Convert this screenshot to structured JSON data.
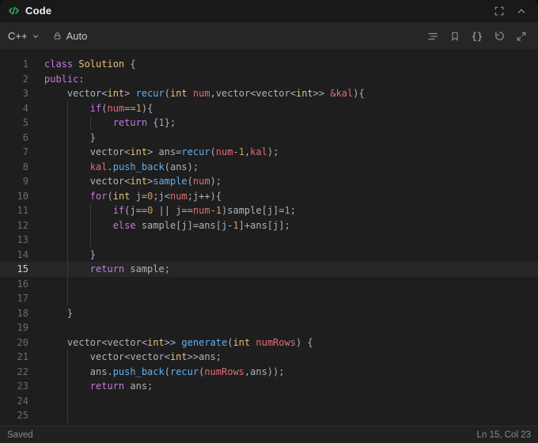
{
  "header": {
    "title": "Code"
  },
  "toolbar": {
    "language": "C++",
    "autocomplete_label": "Auto",
    "braces_glyph": "{}"
  },
  "status_bar": {
    "save_status": "Saved",
    "cursor_position": "Ln 15, Col 23"
  },
  "icons": {
    "header_left": "code-icon",
    "header_right": [
      "fit-screen-icon",
      "collapse-panel-icon"
    ],
    "language_selector": "chevron-down-icon",
    "autocomplete": "lock-icon",
    "toolbar_right": [
      "format-icon",
      "bookmark-icon",
      "braces-icon",
      "reset-icon",
      "fullscreen-icon"
    ]
  },
  "colors": {
    "green": "#2cbb5d",
    "kw": "#c678dd",
    "ty": "#e5c07b",
    "fn": "#61afef",
    "pm": "#e06c75",
    "nu": "#d19a66",
    "pl": "#abb2bf"
  },
  "editor": {
    "active_line": 15,
    "lines": [
      [
        [
          "kw",
          "class"
        ],
        [
          "pl",
          " "
        ],
        [
          "ty",
          "Solution"
        ],
        [
          "pl",
          " {"
        ]
      ],
      [
        [
          "kw",
          "public"
        ],
        [
          "pl",
          ":"
        ]
      ],
      [
        [
          "pl",
          "    vector<"
        ],
        [
          "ty",
          "int"
        ],
        [
          "pl",
          "> "
        ],
        [
          "fn",
          "recur"
        ],
        [
          "pl",
          "("
        ],
        [
          "ty",
          "int"
        ],
        [
          "pl",
          " "
        ],
        [
          "pm",
          "num"
        ],
        [
          "pl",
          ",vector<vector<"
        ],
        [
          "ty",
          "int"
        ],
        [
          "pl",
          ">> "
        ],
        [
          "pm",
          "&kal"
        ],
        [
          "pl",
          "){"
        ]
      ],
      [
        [
          "pl",
          "        "
        ],
        [
          "kw",
          "if"
        ],
        [
          "pl",
          "("
        ],
        [
          "pm",
          "num"
        ],
        [
          "pl",
          "=="
        ],
        [
          "nu",
          "1"
        ],
        [
          "pl",
          "){"
        ]
      ],
      [
        [
          "pl",
          "            "
        ],
        [
          "kw",
          "return"
        ],
        [
          "pl",
          " {"
        ],
        [
          "nu",
          "1"
        ],
        [
          "pl",
          "};"
        ]
      ],
      [
        [
          "pl",
          "        }"
        ]
      ],
      [
        [
          "pl",
          "        vector<"
        ],
        [
          "ty",
          "int"
        ],
        [
          "pl",
          "> ans="
        ],
        [
          "fn",
          "recur"
        ],
        [
          "pl",
          "("
        ],
        [
          "pm",
          "num"
        ],
        [
          "pl",
          "-"
        ],
        [
          "nu",
          "1"
        ],
        [
          "pl",
          ","
        ],
        [
          "pm",
          "kal"
        ],
        [
          "pl",
          ");"
        ]
      ],
      [
        [
          "pl",
          "        "
        ],
        [
          "pm",
          "kal"
        ],
        [
          "pl",
          "."
        ],
        [
          "fn",
          "push_back"
        ],
        [
          "pl",
          "(ans);"
        ]
      ],
      [
        [
          "pl",
          "        vector<"
        ],
        [
          "ty",
          "int"
        ],
        [
          "pl",
          ">"
        ],
        [
          "fn",
          "sample"
        ],
        [
          "pl",
          "("
        ],
        [
          "pm",
          "num"
        ],
        [
          "pl",
          ");"
        ]
      ],
      [
        [
          "pl",
          "        "
        ],
        [
          "kw",
          "for"
        ],
        [
          "pl",
          "("
        ],
        [
          "ty",
          "int"
        ],
        [
          "pl",
          " j="
        ],
        [
          "nu",
          "0"
        ],
        [
          "pl",
          ";j<"
        ],
        [
          "pm",
          "num"
        ],
        [
          "pl",
          ";j++){"
        ]
      ],
      [
        [
          "pl",
          "            "
        ],
        [
          "kw",
          "if"
        ],
        [
          "pl",
          "(j=="
        ],
        [
          "nu",
          "0"
        ],
        [
          "pl",
          " || j=="
        ],
        [
          "pm",
          "num"
        ],
        [
          "pl",
          "-"
        ],
        [
          "nu",
          "1"
        ],
        [
          "pl",
          ")sample[j]="
        ],
        [
          "nu",
          "1"
        ],
        [
          "pl",
          ";"
        ]
      ],
      [
        [
          "pl",
          "            "
        ],
        [
          "kw",
          "else"
        ],
        [
          "pl",
          " sample[j]=ans[j-"
        ],
        [
          "nu",
          "1"
        ],
        [
          "pl",
          "]+ans[j];"
        ]
      ],
      [],
      [
        [
          "pl",
          "        }"
        ]
      ],
      [
        [
          "pl",
          "        "
        ],
        [
          "kw",
          "return"
        ],
        [
          "pl",
          " sample;"
        ]
      ],
      [],
      [],
      [
        [
          "pl",
          "    }"
        ]
      ],
      [],
      [
        [
          "pl",
          "    vector<vector<"
        ],
        [
          "ty",
          "int"
        ],
        [
          "pl",
          ">> "
        ],
        [
          "fn",
          "generate"
        ],
        [
          "pl",
          "("
        ],
        [
          "ty",
          "int"
        ],
        [
          "pl",
          " "
        ],
        [
          "pm",
          "numRows"
        ],
        [
          "pl",
          ") {"
        ]
      ],
      [
        [
          "pl",
          "        vector<vector<"
        ],
        [
          "ty",
          "int"
        ],
        [
          "pl",
          ">>ans;"
        ]
      ],
      [
        [
          "pl",
          "        ans."
        ],
        [
          "fn",
          "push_back"
        ],
        [
          "pl",
          "("
        ],
        [
          "fn",
          "recur"
        ],
        [
          "pl",
          "("
        ],
        [
          "pm",
          "numRows"
        ],
        [
          "pl",
          ",ans));"
        ]
      ],
      [
        [
          "pl",
          "        "
        ],
        [
          "kw",
          "return"
        ],
        [
          "pl",
          " ans;"
        ]
      ],
      [],
      []
    ]
  }
}
